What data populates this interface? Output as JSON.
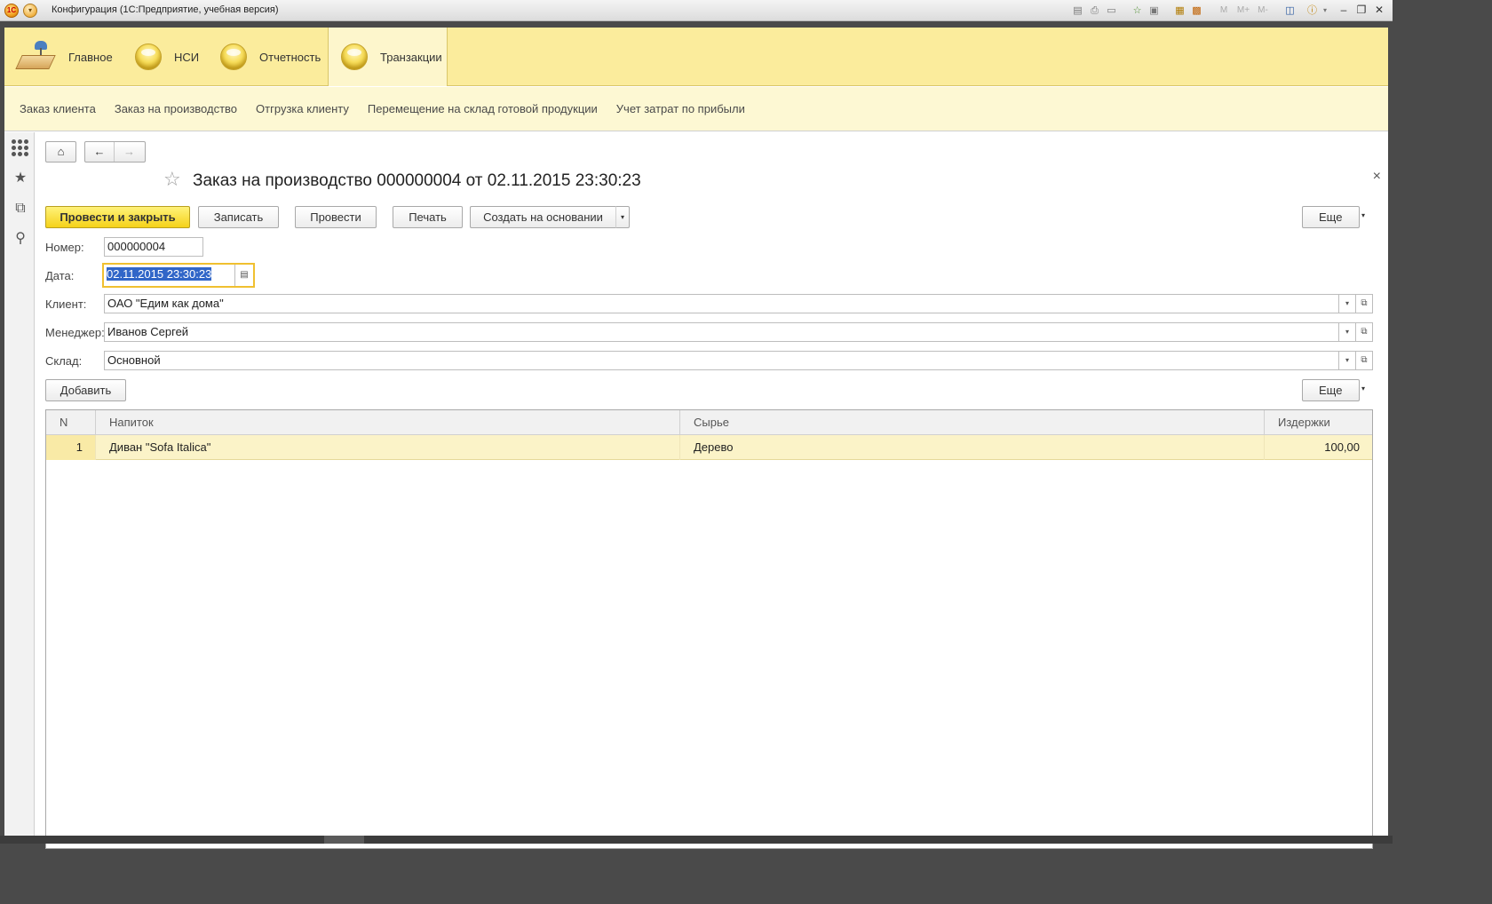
{
  "window": {
    "title": "Конфигурация  (1С:Предприятие, учебная версия)",
    "logo": "1С",
    "toolbar_icons": [
      "save-icon",
      "print-icon",
      "preview-icon",
      "favorite-add-icon",
      "history-icon",
      "calculator-icon",
      "calendar-icon"
    ],
    "memory_buttons": [
      "M",
      "M+",
      "M-"
    ],
    "controls": [
      "minimize-icon",
      "restore-icon",
      "close-icon"
    ]
  },
  "sections": [
    {
      "label": "Главное",
      "icon": "desk-icon",
      "active": false
    },
    {
      "label": "НСИ",
      "icon": "orb-icon",
      "active": false
    },
    {
      "label": "Отчетность",
      "icon": "orb-icon",
      "active": false
    },
    {
      "label": "Транзакции",
      "icon": "orb-icon",
      "active": true
    }
  ],
  "nav_links": [
    "Заказ клиента",
    "Заказ на производство",
    "Отгрузка клиенту",
    "Перемещение на склад готовой продукции",
    "Учет затрат по прибыли"
  ],
  "form": {
    "title": "Заказ на производство 000000004 от 02.11.2015 23:30:23",
    "buttons": {
      "post_close": "Провести и закрыть",
      "save": "Записать",
      "post": "Провести",
      "print": "Печать",
      "create_based": "Создать на основании",
      "more": "Еще",
      "add": "Добавить",
      "more2": "Еще"
    },
    "fields": {
      "number_label": "Номер:",
      "number_value": "000000004",
      "date_label": "Дата:",
      "date_value": "02.11.2015 23:30:23",
      "client_label": "Клиент:",
      "client_value": "ОАО \"Едим как дома\"",
      "manager_label": "Менеджер:",
      "manager_value": "Иванов Сергей",
      "warehouse_label": "Склад:",
      "warehouse_value": "Основной"
    },
    "table": {
      "columns": [
        "N",
        "Напиток",
        "Сырье",
        "Издержки"
      ],
      "rows": [
        {
          "n": "1",
          "drink": "Диван \"Sofa Italica\"",
          "material": "Дерево",
          "cost": "100,00"
        }
      ]
    }
  },
  "colors": {
    "section_bar": "#fbec9c",
    "nav_bar": "#fdf8d3",
    "primary_button": "#f5d21a",
    "selected_row": "#fbf3c8",
    "selection": "#3166c8"
  }
}
